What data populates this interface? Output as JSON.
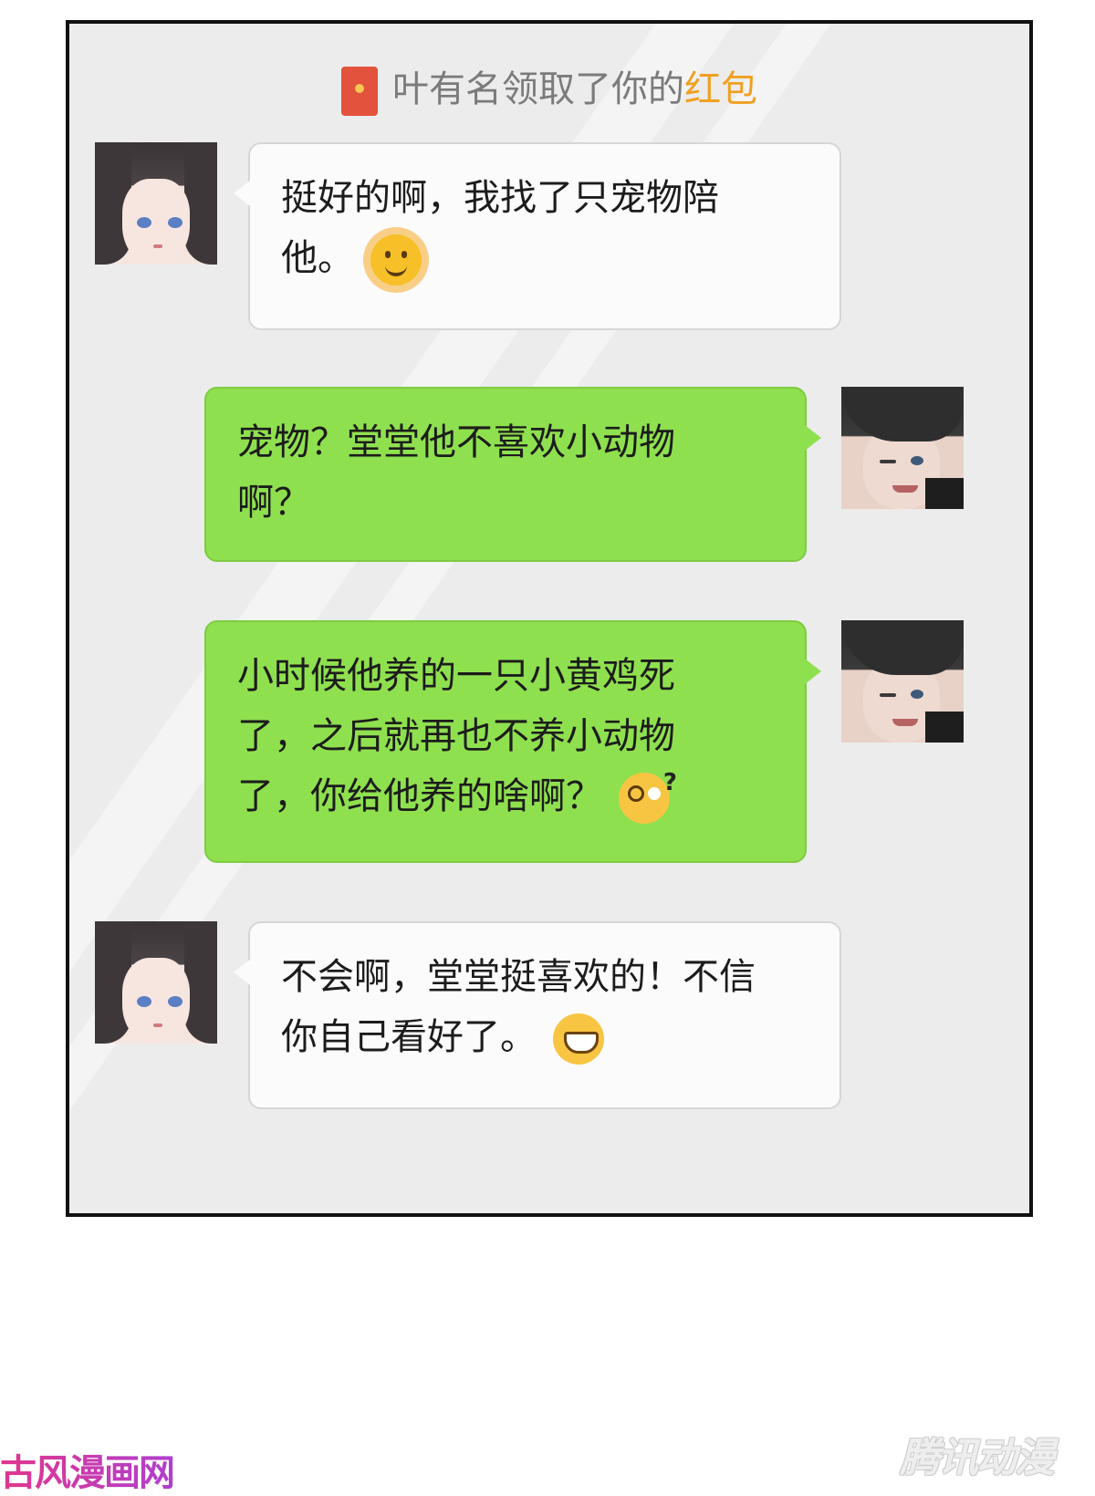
{
  "notice": {
    "text": "叶有名领取了你的",
    "highlight": "红包",
    "icon": "red-packet-icon"
  },
  "messages": [
    {
      "sender": "girl",
      "side": "left",
      "lines": [
        "挺好的啊，我找了只宠物陪",
        "他。"
      ],
      "emoji": "sun-emoji"
    },
    {
      "sender": "boy",
      "side": "right",
      "lines": [
        "宠物？堂堂他不喜欢小动物",
        "啊？"
      ]
    },
    {
      "sender": "boy",
      "side": "right",
      "lines": [
        "小时候他养的一只小黄鸡死",
        "了，之后就再也不养小动物",
        "了，你给他养的啥啊？"
      ],
      "emoji": "dizzy-question-emoji"
    },
    {
      "sender": "girl",
      "side": "left",
      "lines": [
        "不会啊，堂堂挺喜欢的！不信",
        "你自己看好了。"
      ],
      "emoji": "grin-emoji"
    }
  ],
  "watermarks": {
    "left": "古风漫画网",
    "right": "腾讯动漫"
  },
  "colors": {
    "panel_bg": "#ececec",
    "green_bubble": "#8fe04f",
    "white_bubble": "#fbfbfb",
    "notice_highlight": "#f0a020"
  }
}
